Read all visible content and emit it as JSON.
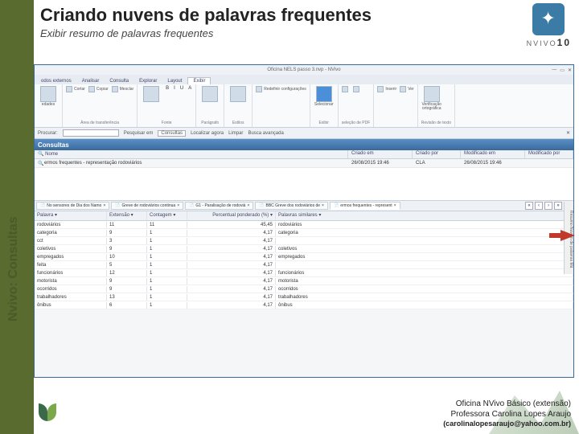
{
  "slide": {
    "title": "Criando nuvens de palavras frequentes",
    "subtitle": "Exibir resumo de palavras frequentes",
    "side_label": "Nvivo: Consultas",
    "logo_brand": "NVIVO",
    "logo_version": "10"
  },
  "app": {
    "window_title": "Oficina NELS passo 3.nvp - NVivo",
    "menu": [
      "odos externos",
      "Analisar",
      "Consulta",
      "Explorar",
      "Layout",
      "Exibir"
    ],
    "menu_active_index": 5,
    "ribbon_groups": [
      {
        "label": "",
        "big": [
          {
            "name": "propriedades",
            "label": "edades"
          }
        ]
      },
      {
        "label": "Área de transferência",
        "items": [
          {
            "name": "cortar",
            "label": "Cortar"
          },
          {
            "name": "copiar",
            "label": "Copiar"
          },
          {
            "name": "mesclar",
            "label": "Mesclar"
          }
        ]
      },
      {
        "label": "Fonte",
        "big": [
          {
            "name": "fonte-dropdown",
            "label": ""
          }
        ],
        "extra": [
          "B",
          "I",
          "U",
          "A"
        ]
      },
      {
        "label": "Parágrafo",
        "big": [
          {
            "name": "paragrafo",
            "label": ""
          }
        ]
      },
      {
        "label": "Estilos",
        "big": [
          {
            "name": "estilos",
            "label": ""
          }
        ]
      },
      {
        "label": "",
        "items": [
          {
            "name": "redefinir",
            "label": "Redefinir configurações"
          }
        ]
      },
      {
        "label": "Exibir",
        "big": [
          {
            "name": "selecionar",
            "label": "Selecionar"
          }
        ]
      },
      {
        "label": "seleção de PDF",
        "items": [
          {
            "name": "pdf1",
            "label": ""
          },
          {
            "name": "pdf2",
            "label": ""
          }
        ]
      },
      {
        "label": "",
        "items": [
          {
            "name": "inserir",
            "label": "Inserir"
          },
          {
            "name": "ver",
            "label": "Ver"
          }
        ]
      },
      {
        "label": "Revisão de texto",
        "big": [
          {
            "name": "abc",
            "label": "Verificação ortográfica"
          }
        ]
      }
    ],
    "searchbar": {
      "procurar": "Procurar:",
      "pesquisar": "Pesquisar em",
      "consultas": "Consultas",
      "localizar": "Localizar agora",
      "limpar": "Limpar",
      "avancada": "Busca avançada"
    },
    "segment_title": "Consultas",
    "columns": [
      "Nome",
      "Criado em",
      "Criado por",
      "Modificado em",
      "Modificado por"
    ],
    "query_row": {
      "name": "ermos frequentes - representação rodoviários",
      "created": "26/08/2015 19:46",
      "creator": "CLA",
      "modified": "26/08/2015 19:46",
      "modifier": ""
    },
    "tabs": [
      {
        "name": "sensores",
        "label": "No sensores de Dia dos Namo"
      },
      {
        "name": "greve",
        "label": "Greve de rodoviários continua"
      },
      {
        "name": "g1",
        "label": "G1 - Paralisação de rodoviá"
      },
      {
        "name": "bbc",
        "label": "BBC Greve dos rodoviários de"
      },
      {
        "name": "ermos",
        "label": "ermos frequentes - represent"
      }
    ],
    "tab_active_index": 4,
    "tabnav": [
      "«",
      "‹",
      "›",
      "»",
      "×"
    ],
    "side_panel": "Resumo  Nuvem de palavras  Má",
    "word_columns": [
      "Palavra",
      "Extensão",
      "Contagem",
      "Percentual ponderado (%)",
      "Palavras similares"
    ],
    "word_rows": [
      {
        "w": "rodoviários",
        "e": "11",
        "c": "11",
        "p": "45,45",
        "s": "rodoviários"
      },
      {
        "w": "categoria",
        "e": "9",
        "c": "1",
        "p": "4,17",
        "s": "categoria"
      },
      {
        "w": "cct",
        "e": "3",
        "c": "1",
        "p": "4,17",
        "s": ""
      },
      {
        "w": "coletivos",
        "e": "9",
        "c": "1",
        "p": "4,17",
        "s": "coletivos"
      },
      {
        "w": "empregados",
        "e": "10",
        "c": "1",
        "p": "4,17",
        "s": "empregados"
      },
      {
        "w": "feita",
        "e": "5",
        "c": "1",
        "p": "4,17",
        "s": ""
      },
      {
        "w": "funcionários",
        "e": "12",
        "c": "1",
        "p": "4,17",
        "s": "funcionários"
      },
      {
        "w": "motorista",
        "e": "9",
        "c": "1",
        "p": "4,17",
        "s": "motorista"
      },
      {
        "w": "ocorridos",
        "e": "9",
        "c": "1",
        "p": "4,17",
        "s": "ocorridos"
      },
      {
        "w": "trabalhadores",
        "e": "13",
        "c": "1",
        "p": "4,17",
        "s": "trabalhadores"
      },
      {
        "w": "ônibus",
        "e": "6",
        "c": "1",
        "p": "4,17",
        "s": "ônibus"
      }
    ]
  },
  "footer": {
    "line1": "Oficina NVivo Básico (extensão)",
    "line2": "Professora Carolina Lopes Araujo",
    "line3": "(carolinalopesaraujo@yahoo.com.br)"
  }
}
